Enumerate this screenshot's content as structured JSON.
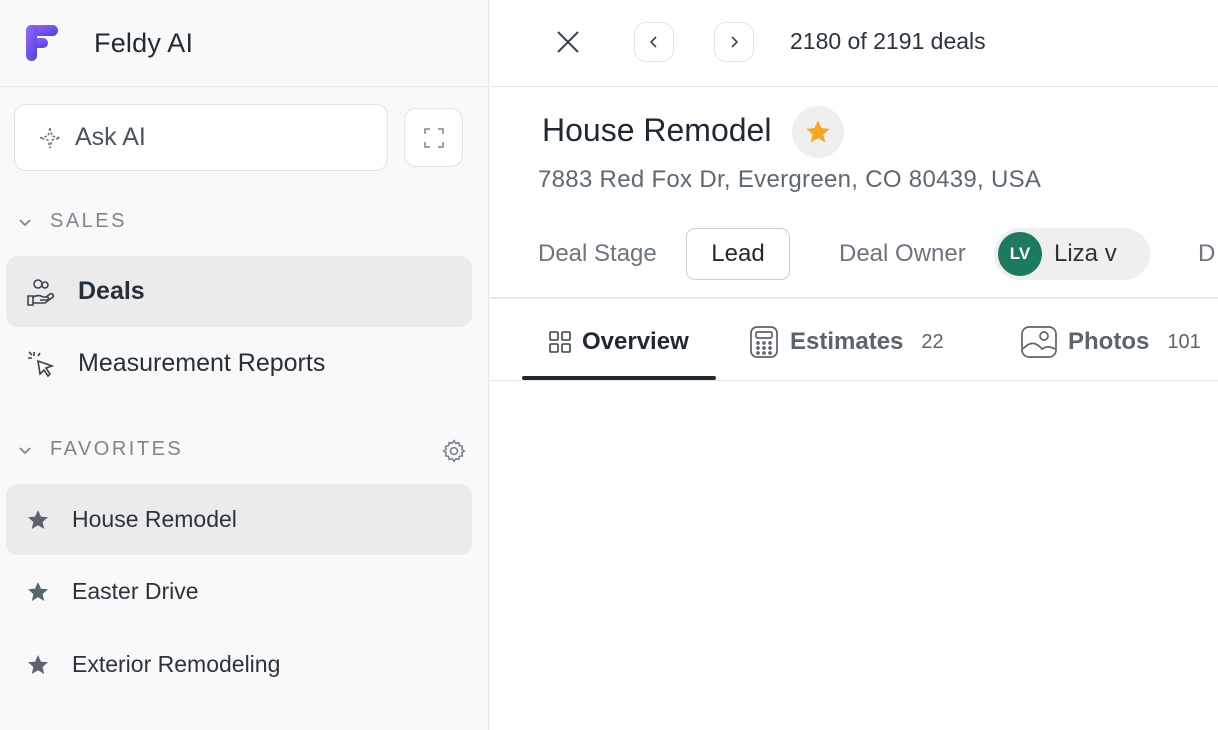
{
  "app": {
    "name": "Feldy AI",
    "brand_color": "#7b5cf0"
  },
  "sidebar": {
    "ask_ai": {
      "label": "Ask AI"
    },
    "sales": {
      "header": "SALES",
      "items": [
        {
          "label": "Deals",
          "icon": "deals-icon",
          "active": true
        },
        {
          "label": "Measurement Reports",
          "icon": "cursor-click-icon",
          "active": false
        }
      ]
    },
    "favorites": {
      "header": "FAVORITES",
      "items": [
        {
          "label": "House Remodel",
          "active": true
        },
        {
          "label": "Easter Drive",
          "active": false
        },
        {
          "label": "Exterior Remodeling",
          "active": false
        }
      ]
    }
  },
  "topbar": {
    "pager_text": "2180 of 2191 deals"
  },
  "deal": {
    "title": "House Remodel",
    "starred": true,
    "star_color": "#f5a623",
    "address": "7883 Red Fox Dr, Evergreen, CO 80439, USA",
    "stage_label": "Deal Stage",
    "stage_value": "Lead",
    "owner_label": "Deal Owner",
    "owner_initials": "LV",
    "owner_name": "Liza v",
    "owner_avatar_color": "#1c7a61",
    "next_label_cut": "D"
  },
  "tabs": [
    {
      "label": "Overview",
      "icon": "grid-icon",
      "active": true,
      "count": ""
    },
    {
      "label": "Estimates",
      "icon": "calculator-icon",
      "active": false,
      "count": "22"
    },
    {
      "label": "Photos",
      "icon": "image-icon",
      "active": false,
      "count": "101"
    }
  ]
}
